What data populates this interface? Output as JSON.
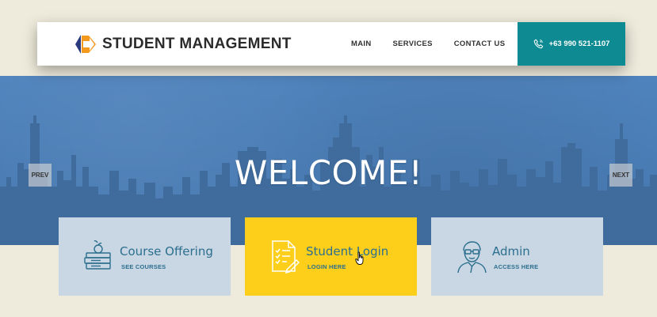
{
  "header": {
    "brand_name": "STUDENT MANAGEMENT",
    "menu": [
      "MAIN",
      "SERVICES",
      "CONTACT US"
    ],
    "phone": "+63 990 521-1107"
  },
  "hero": {
    "title": "WELCOME!",
    "prev_label": "PREV",
    "next_label": "NEXT"
  },
  "cards": [
    {
      "title": "Course Offering",
      "subtitle": "SEE COURSES",
      "icon": "books-apple-icon"
    },
    {
      "title": "Student Login",
      "subtitle": "LOGIN HERE",
      "icon": "checklist-document-icon"
    },
    {
      "title": "Admin",
      "subtitle": "ACCESS HERE",
      "icon": "admin-person-icon"
    }
  ],
  "colors": {
    "background": "#efebdc",
    "hero_blue": "#4b7fb8",
    "skyline": "#3f6c9d",
    "accent_teal": "#0e8a93",
    "card_blue": "#c9d6e3",
    "card_yellow": "#fdcf1b",
    "card_text": "#2c6f8e"
  }
}
